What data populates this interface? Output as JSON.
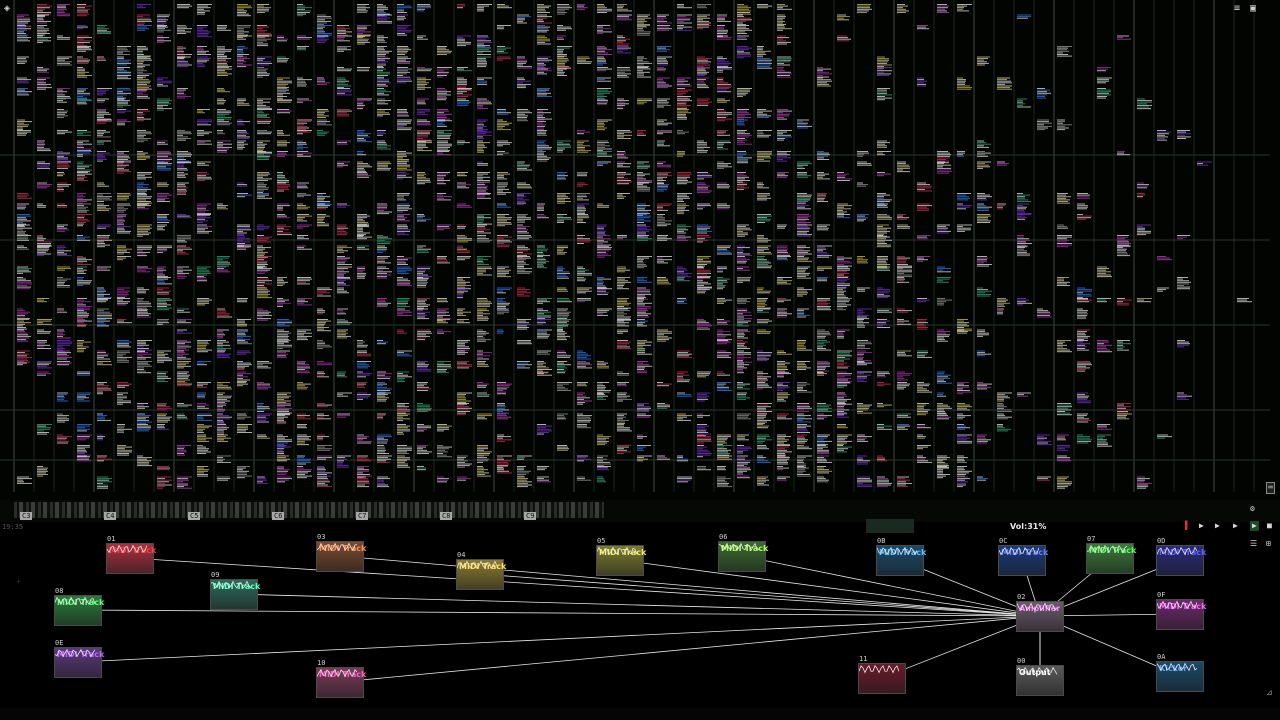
{
  "app": {
    "name": "SunVox"
  },
  "tracker": {
    "icons": {
      "menu": "hamburger-menu-icon",
      "lock": "lock-icon",
      "logo": "sunvox-logo-icon"
    }
  },
  "keyboard": {
    "octaves": [
      "C3",
      "C4",
      "C5",
      "C6",
      "C7",
      "C8",
      "C9"
    ]
  },
  "status": {
    "time": "19:35",
    "volume": "Vol:31%"
  },
  "modules": [
    {
      "id": "01",
      "label": "MIDI Track",
      "color": "#a83040",
      "text": "#ff4040"
    },
    {
      "id": "03",
      "label": "MIDI Track",
      "color": "#7a4a30",
      "text": "#ff9050"
    },
    {
      "id": "04",
      "label": "MIDI Track",
      "color": "#8a7a30",
      "text": "#ffe060"
    },
    {
      "id": "05",
      "label": "MIDI Track",
      "color": "#7a7a30",
      "text": "#f0f060"
    },
    {
      "id": "06",
      "label": "MIDI Track",
      "color": "#3a6a30",
      "text": "#b0ff60"
    },
    {
      "id": "0B",
      "label": "MIDI Track",
      "color": "#1a4a6a",
      "text": "#60c0ff"
    },
    {
      "id": "0C",
      "label": "MIDI Track",
      "color": "#1a3a7a",
      "text": "#6080ff"
    },
    {
      "id": "07",
      "label": "MIDI Track",
      "color": "#3a7a3a",
      "text": "#60ff60"
    },
    {
      "id": "0D",
      "label": "MIDI Track",
      "color": "#2a2a7a",
      "text": "#6060ff"
    },
    {
      "id": "08",
      "label": "MIDI Track",
      "color": "#2a7a3a",
      "text": "#60ff80"
    },
    {
      "id": "09",
      "label": "MIDI Track",
      "color": "#2a6a5a",
      "text": "#60ffc0"
    },
    {
      "id": "02",
      "label": "Amplifier",
      "color": "#6a5a6a",
      "text": "#ff80ff"
    },
    {
      "id": "0F",
      "label": "MIDI Track",
      "color": "#6a2a6a",
      "text": "#ff60ff"
    },
    {
      "id": "0E",
      "label": "MIDI Track",
      "color": "#5a3a7a",
      "text": "#c060ff"
    },
    {
      "id": "10",
      "label": "MIDI Track",
      "color": "#7a3a5a",
      "text": "#ff60c0"
    },
    {
      "id": "11",
      "label": "",
      "color": "#6a1a2a",
      "text": "#ff4060"
    },
    {
      "id": "00",
      "label": "Output",
      "color": "#5a5a5a",
      "text": "#ffffff"
    },
    {
      "id": "0A",
      "label": "Kicker",
      "color": "#1a4a6a",
      "text": "#60a0ff"
    }
  ],
  "colors": {
    "background": "#000000",
    "grid": "#3a4a3a",
    "link": "#e8e8e8"
  }
}
